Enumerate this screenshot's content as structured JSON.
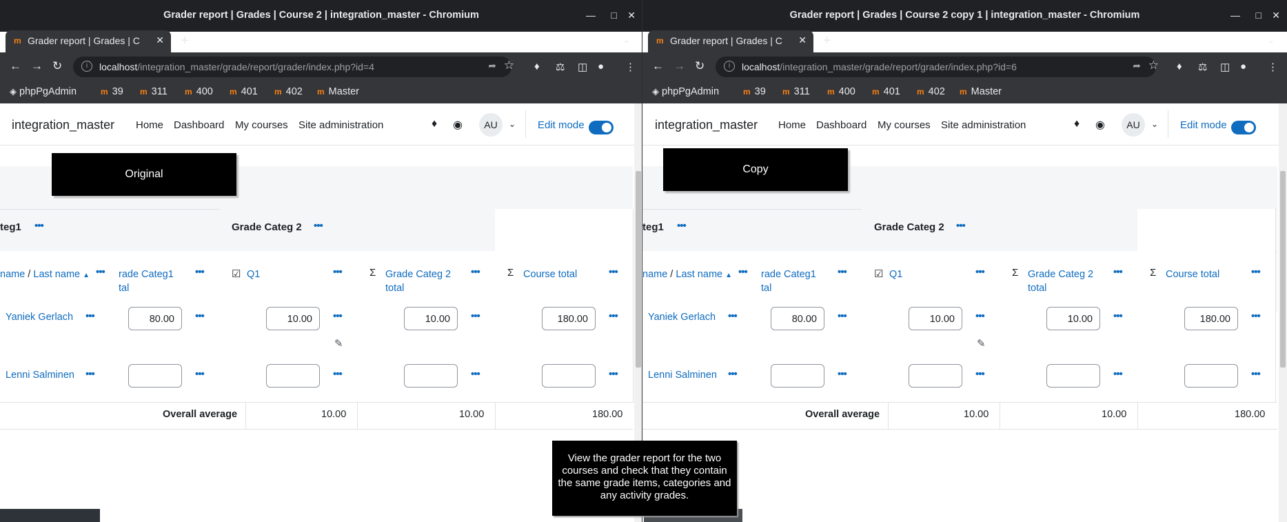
{
  "tooltip": "View the grader report for the two courses and check that they contain the same grade items, categories and any activity grades.",
  "windows": [
    {
      "window_title": "Grader report | Grades | Course 2 | integration_master - Chromium",
      "tab_title": "Grader report | Grades | C",
      "url_host": "localhost",
      "url_path": "/integration_master/grade/report/grader/index.php?id=4",
      "bookmarks": [
        "phpPgAdmin",
        "39",
        "311",
        "400",
        "401",
        "402",
        "Master"
      ],
      "site_name": "integration_master",
      "nav": [
        "Home",
        "Dashboard",
        "My courses",
        "Site administration"
      ],
      "avatar": "AU",
      "edit_mode": "Edit mode",
      "overlay_label": "Original",
      "categories": [
        "teg1",
        "Grade Categ 2"
      ],
      "headers": {
        "name_first": "name",
        "name_sep": " / ",
        "name_last": "Last name",
        "categ1_line1": "rade Categ1",
        "categ1_line2": "tal",
        "q1": "Q1",
        "categ2_line1": "Grade Categ 2",
        "categ2_line2": "total",
        "course_total": "Course total"
      },
      "students": [
        {
          "name": "Yaniek Gerlach",
          "categ1_total": "80.00",
          "q1": "10.00",
          "categ2_total": "10.00",
          "course_total": "180.00"
        },
        {
          "name": "Lenni Salminen",
          "categ1_total": "",
          "q1": "",
          "categ2_total": "",
          "course_total": ""
        }
      ],
      "overall_average": {
        "label": "Overall average",
        "q1": "10.00",
        "categ2_total": "10.00",
        "course_total": "180.00"
      }
    },
    {
      "window_title": "Grader report | Grades | Course 2 copy 1 | integration_master - Chromium",
      "tab_title": "Grader report | Grades | C",
      "url_host": "localhost",
      "url_path": "/integration_master/grade/report/grader/index.php?id=6",
      "bookmarks": [
        "phpPgAdmin",
        "39",
        "311",
        "400",
        "401",
        "402",
        "Master"
      ],
      "site_name": "integration_master",
      "nav": [
        "Home",
        "Dashboard",
        "My courses",
        "Site administration"
      ],
      "avatar": "AU",
      "edit_mode": "Edit mode",
      "overlay_label": "Copy",
      "categories": [
        "teg1",
        "Grade Categ 2"
      ],
      "headers": {
        "name_first": "name",
        "name_sep": " / ",
        "name_last": "Last name",
        "categ1_line1": "rade Categ1",
        "categ1_line2": "tal",
        "q1": "Q1",
        "categ2_line1": "Grade Categ 2",
        "categ2_line2": "total",
        "course_total": "Course total"
      },
      "students": [
        {
          "name": "Yaniek Gerlach",
          "categ1_total": "80.00",
          "q1": "10.00",
          "categ2_total": "10.00",
          "course_total": "180.00"
        },
        {
          "name": "Lenni Salminen",
          "categ1_total": "",
          "q1": "",
          "categ2_total": "",
          "course_total": ""
        }
      ],
      "overall_average": {
        "label": "Overall average",
        "q1": "10.00",
        "categ2_total": "10.00",
        "course_total": "180.00"
      }
    }
  ]
}
